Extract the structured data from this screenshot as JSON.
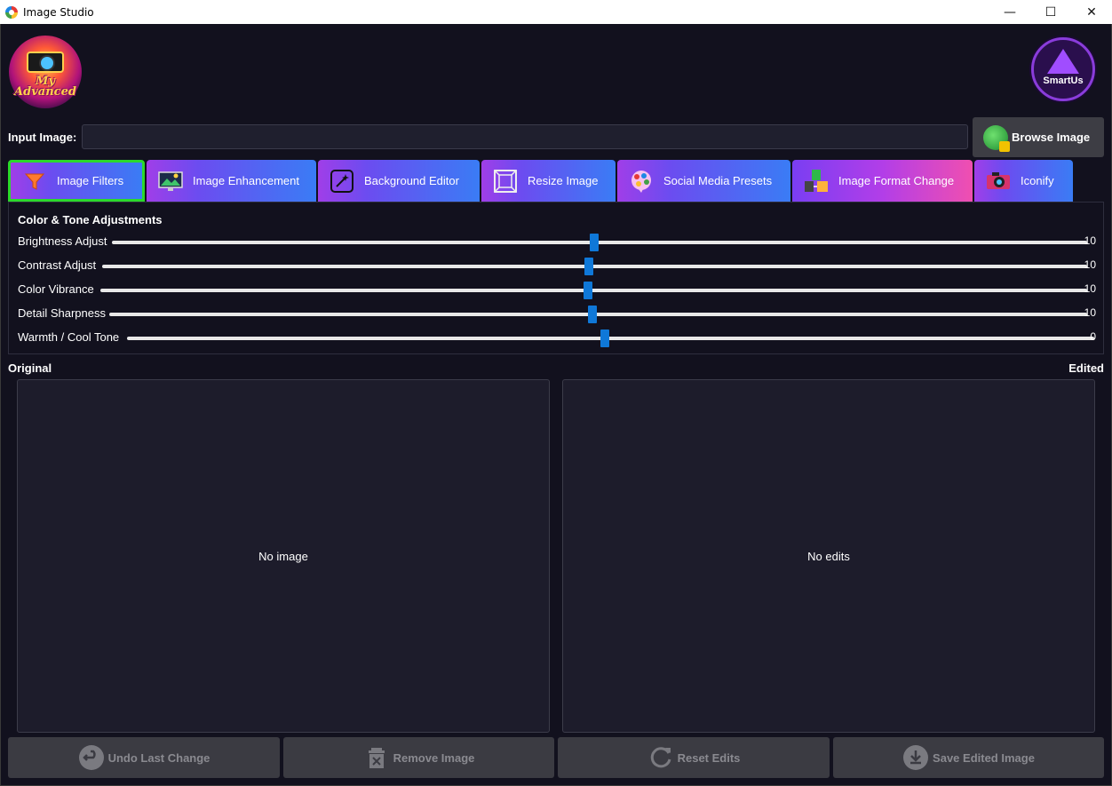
{
  "window": {
    "title": "Image Studio",
    "controls": {
      "minimize": "—",
      "maximize": "☐",
      "close": "✕"
    }
  },
  "logos": {
    "left_text": "My Advanced",
    "right_text": "SmartUs"
  },
  "input": {
    "label": "Input Image:",
    "value": "",
    "browse_label": "Browse Image"
  },
  "tabs": [
    {
      "label": "Image Filters",
      "icon": "funnel-icon",
      "active": true
    },
    {
      "label": "Image Enhancement",
      "icon": "monitor-image-icon"
    },
    {
      "label": "Background Editor",
      "icon": "sparkle-edit-icon"
    },
    {
      "label": "Resize Image",
      "icon": "resize-frame-icon"
    },
    {
      "label": "Social Media Presets",
      "icon": "social-bubble-icon"
    },
    {
      "label": "Image Format Change",
      "icon": "file-format-icon"
    },
    {
      "label": "Iconify",
      "icon": "camera-icon"
    }
  ],
  "adjustments": {
    "title": "Color & Tone Adjustments",
    "sliders": [
      {
        "label": "Brightness Adjust",
        "value": "10"
      },
      {
        "label": "Contrast Adjust",
        "value": "10"
      },
      {
        "label": "Color Vibrance",
        "value": "10"
      },
      {
        "label": "Detail Sharpness",
        "value": "10"
      },
      {
        "label": "Warmth / Cool Tone",
        "value": "0"
      }
    ]
  },
  "preview": {
    "original_label": "Original",
    "edited_label": "Edited",
    "original_placeholder": "No image",
    "edited_placeholder": "No edits"
  },
  "actions": {
    "undo": "Undo Last Change",
    "remove": "Remove Image",
    "reset": "Reset Edits",
    "save": "Save Edited Image"
  },
  "colors": {
    "background": "#12111e",
    "slider_thumb": "#0f78d8",
    "active_tab_border": "#2bd92b",
    "tab_gradient_start": "#a03ee8",
    "tab_gradient_end": "#3a7cf5"
  }
}
